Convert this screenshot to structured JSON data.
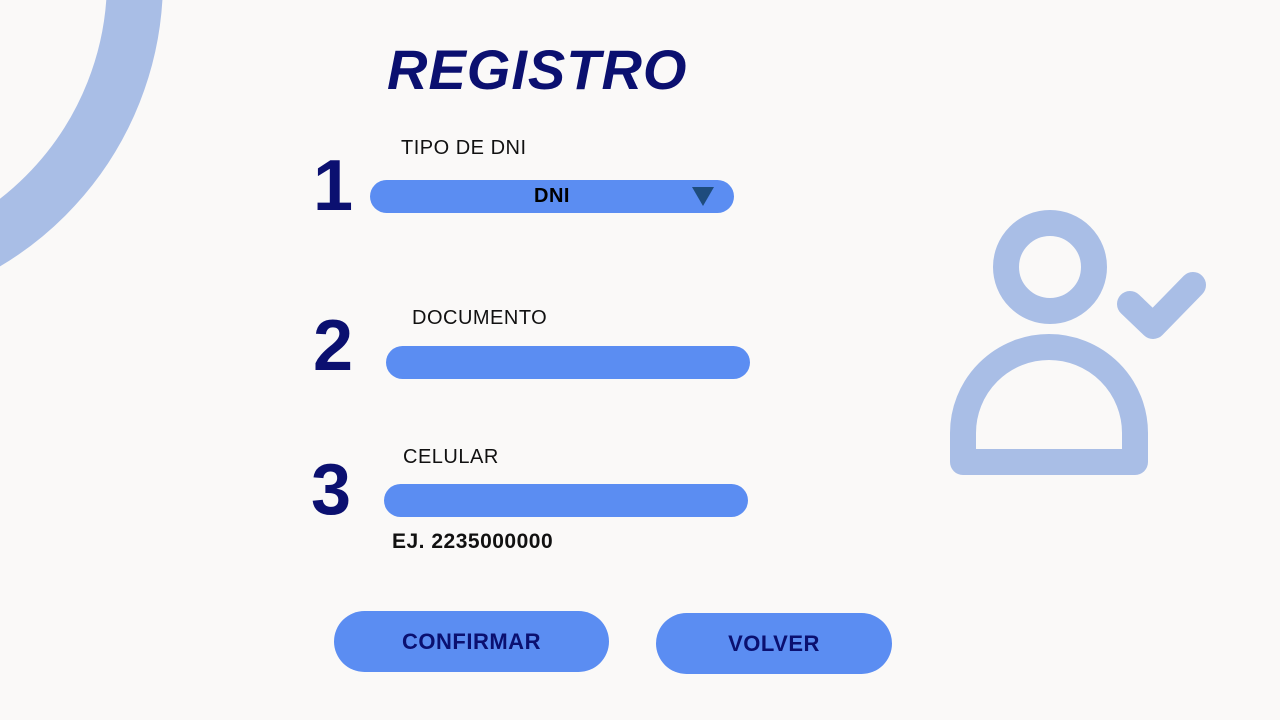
{
  "page": {
    "title": "REGISTRO"
  },
  "form": {
    "step1": {
      "number": "1",
      "label": "TIPO DE DNI",
      "selected": "DNI"
    },
    "step2": {
      "number": "2",
      "label": "DOCUMENTO",
      "value": ""
    },
    "step3": {
      "number": "3",
      "label": "CELULAR",
      "value": "",
      "hint": "EJ. 2235000000"
    }
  },
  "actions": {
    "confirm_label": "CONFIRMAR",
    "back_label": "VOLVER"
  },
  "icons": {
    "user": "user-check-icon",
    "dropdown": "triangle-down-icon"
  },
  "colors": {
    "background": "#faf9f8",
    "primary_dark": "#0b1070",
    "field_fill": "#5b8df2",
    "decoration": "#a9bee6",
    "dropdown_arrow": "#1e4c7d"
  }
}
